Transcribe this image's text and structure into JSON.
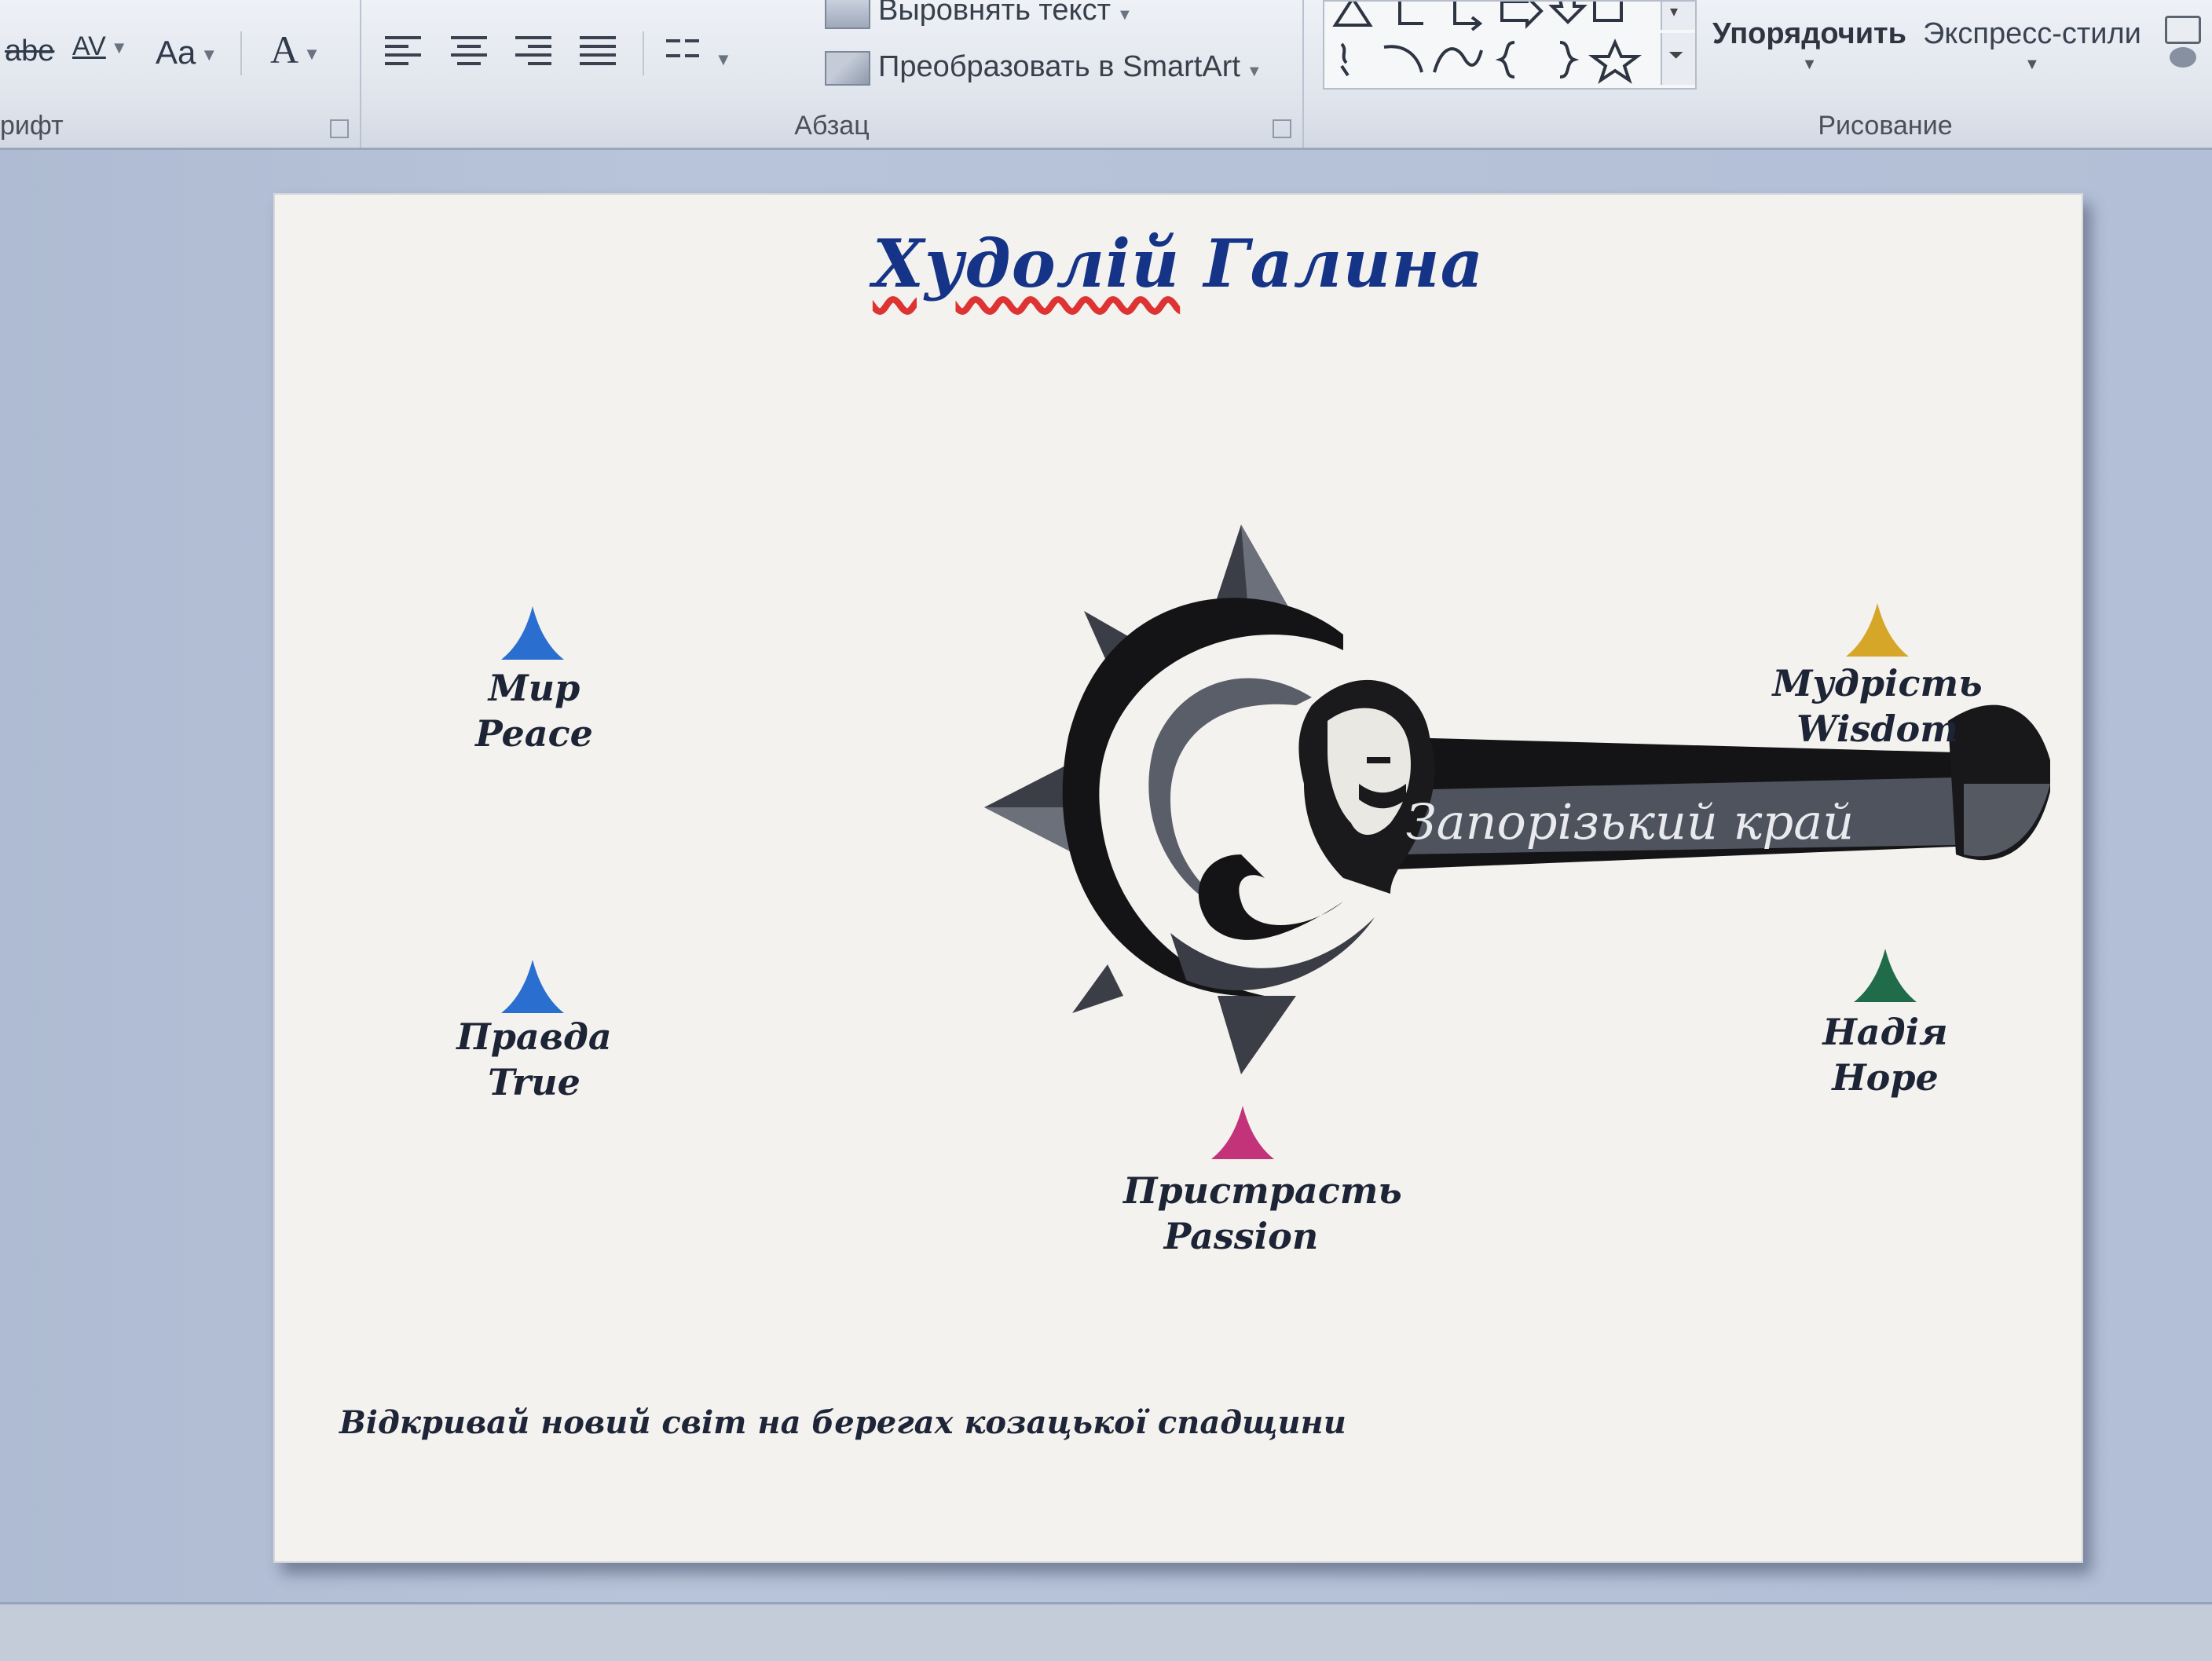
{
  "ribbon": {
    "font_group": {
      "label": "рифт",
      "strike_btn": "abe",
      "spacing_btn": "AV",
      "case_btn": "Aa",
      "color_btn": "A"
    },
    "paragraph_group": {
      "label": "Абзац",
      "align_text": "Выровнять текст",
      "convert_smartart": "Преобразовать в SmartArt"
    },
    "drawing_group": {
      "label": "Рисование",
      "arrange": "Упорядочить",
      "quick_styles": "Экспресс-стили"
    }
  },
  "slide": {
    "title_part1": "Худолій",
    "title_part2": "Галина",
    "banner_text": "Запорізький край",
    "values": [
      {
        "ua": "Мир",
        "en": "Peace",
        "color": "#2a6fd0"
      },
      {
        "ua": "Правда",
        "en": "True",
        "color": "#2a6fd0"
      },
      {
        "ua": "Пристрасть",
        "en": "Passion",
        "color": "#c3337a"
      },
      {
        "ua": "Мудрість",
        "en": "Wisdom",
        "color": "#d6a628"
      },
      {
        "ua": "Надія",
        "en": "Hope",
        "color": "#1f6b4a"
      }
    ],
    "tagline": "Відкривай новий світ на берегах козацької спадщини"
  }
}
